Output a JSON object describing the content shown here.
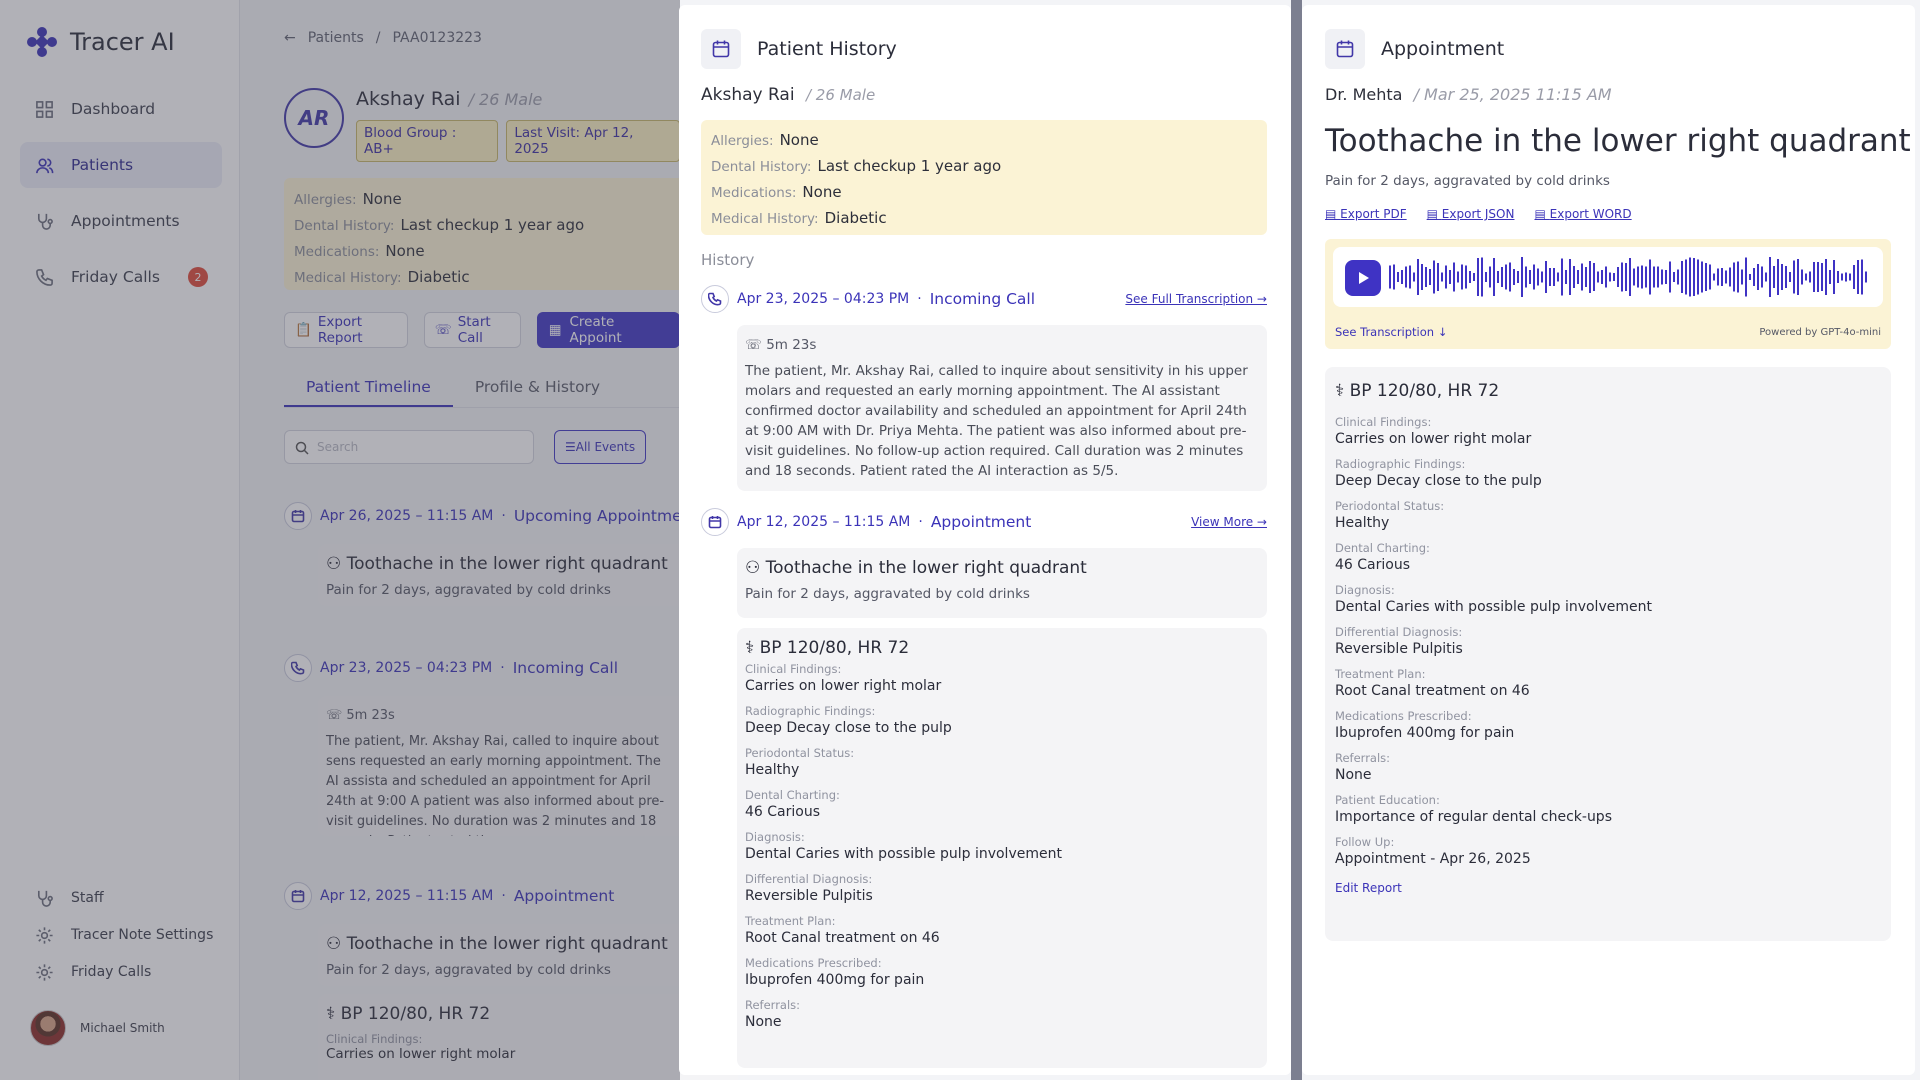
{
  "app": {
    "name": "Tracer AI"
  },
  "sidebar": {
    "items": [
      {
        "label": "Dashboard"
      },
      {
        "label": "Patients"
      },
      {
        "label": "Appointments"
      },
      {
        "label": "Friday Calls",
        "badge": "2"
      }
    ],
    "bottom": [
      {
        "label": "Staff"
      },
      {
        "label": "Tracer Note Settings"
      },
      {
        "label": "Friday Calls"
      }
    ],
    "user": "Michael Smith"
  },
  "main": {
    "breadcrumb": {
      "root": "Patients",
      "sep": "/",
      "id": "PAA0123223"
    },
    "avatar": "AR",
    "name": "Akshay Rai",
    "age_gender": "/ 26 Male",
    "chips": [
      "Blood Group : AB+",
      "Last Visit: Apr 12, 2025"
    ],
    "alert": [
      {
        "k": "Allergies:",
        "v": "None"
      },
      {
        "k": "Dental History:",
        "v": "Last checkup 1 year ago"
      },
      {
        "k": "Medications:",
        "v": "None"
      },
      {
        "k": "Medical History:",
        "v": "Diabetic"
      }
    ],
    "buttons": {
      "export": "Export Report",
      "call": "Start Call",
      "create": "Create Appoint"
    },
    "tabs": [
      "Patient Timeline",
      "Profile & History"
    ],
    "search_placeholder": "Search",
    "filter": "All Events",
    "timeline": [
      {
        "date": "Apr 26, 2025 – 11:15 AM",
        "type": "Upcoming Appointment",
        "title": "Toothache in the lower right quadrant",
        "sub": "Pain for 2 days, aggravated by cold drinks"
      },
      {
        "date": "Apr 23, 2025 –  04:23 PM",
        "type": "Incoming Call",
        "duration": "5m 23s",
        "text": "The patient, Mr. Akshay Rai, called to inquire about sens requested an early morning appointment. The AI assista and scheduled an appointment for April 24th at 9:00 A patient was also informed about pre-visit guidelines. No duration was 2 minutes and 18 seconds. Patient rated th"
      },
      {
        "date": "Apr 12, 2025 – 11:15 AM",
        "type": "Appointment",
        "title": "Toothache in the lower right quadrant",
        "sub": "Pain for 2 days, aggravated by cold drinks",
        "vitals": "BP 120/80, HR 72",
        "cf_label": "Clinical Findings:",
        "cf_value": "Carries on lower right molar"
      }
    ]
  },
  "history": {
    "title": "Patient History",
    "name": "Akshay Rai",
    "age_gender": "/ 26 Male",
    "alert": [
      {
        "k": "Allergies:",
        "v": "None"
      },
      {
        "k": "Dental History:",
        "v": "Last checkup 1 year ago"
      },
      {
        "k": "Medications:",
        "v": "None"
      },
      {
        "k": "Medical History:",
        "v": "Diabetic"
      }
    ],
    "section": "History",
    "call": {
      "date": "Apr 23, 2025 –  04:23 PM",
      "type": "Incoming Call",
      "link": "See Full Transcription →",
      "duration": "5m 23s",
      "text": "The patient, Mr. Akshay Rai, called to inquire about sensitivity in his upper molars and requested an early morning appointment. The AI assistant confirmed doctor availability and scheduled an appointment for April 24th at 9:00 AM with Dr. Priya Mehta. The patient was also informed about pre-visit guidelines. No follow-up action required. Call duration was 2 minutes and 18 seconds. Patient rated the AI interaction as 5/5."
    },
    "appointment": {
      "date": "Apr 12, 2025 – 11:15 AM",
      "type": "Appointment",
      "link": "View More →",
      "title": "Toothache in the lower right quadrant",
      "sub": "Pain for 2 days, aggravated by cold drinks",
      "vitals": "BP 120/80, HR 72",
      "fields": [
        {
          "k": "Clinical Findings:",
          "v": "Carries on lower right molar"
        },
        {
          "k": "Radiographic Findings:",
          "v": "Deep Decay close to the pulp"
        },
        {
          "k": "Periodontal Status:",
          "v": "Healthy"
        },
        {
          "k": "Dental Charting:",
          "v": "46 Carious"
        },
        {
          "k": "Diagnosis:",
          "v": "Dental Caries with possible pulp involvement"
        },
        {
          "k": "Differential Diagnosis:",
          "v": "Reversible Pulpitis"
        },
        {
          "k": "Treatment Plan:",
          "v": "Root Canal treatment on 46"
        },
        {
          "k": "Medications Prescribed:",
          "v": "Ibuprofen 400mg for pain"
        },
        {
          "k": "Referrals:",
          "v": "None"
        }
      ]
    }
  },
  "appointment_panel": {
    "title": "Appointment",
    "doctor": "Dr. Mehta",
    "datetime": "/ Mar 25, 2025 11:15 AM",
    "heading": "Toothache in the lower right quadrant",
    "sub": "Pain for 2 days, aggravated by cold drinks",
    "exports": [
      "Export PDF",
      "Export JSON",
      "Export WORD"
    ],
    "see_transcription": "See Transcription ↓",
    "powered": "Powered by GPT-4o-mini",
    "vitals": "BP 120/80, HR 72",
    "fields": [
      {
        "k": "Clinical Findings:",
        "v": "Carries on lower right molar"
      },
      {
        "k": "Radiographic Findings:",
        "v": "Deep Decay close to the pulp"
      },
      {
        "k": "Periodontal Status:",
        "v": "Healthy"
      },
      {
        "k": "Dental Charting:",
        "v": "46 Carious"
      },
      {
        "k": "Diagnosis:",
        "v": "Dental Caries with possible pulp involvement"
      },
      {
        "k": "Differential Diagnosis:",
        "v": "Reversible Pulpitis"
      },
      {
        "k": "Treatment Plan:",
        "v": "Root Canal treatment on 46"
      },
      {
        "k": "Medications Prescribed:",
        "v": "Ibuprofen 400mg for pain"
      },
      {
        "k": "Referrals:",
        "v": "None"
      },
      {
        "k": "Patient Education:",
        "v": "Importance of regular dental check-ups"
      },
      {
        "k": "Follow Up:",
        "v": "Appointment - Apr 26, 2025"
      }
    ],
    "edit": "Edit Report"
  },
  "colors": {
    "accent": "#3b33b8",
    "alert_bg": "#fbf3d5",
    "badge": "#e04a3a"
  }
}
